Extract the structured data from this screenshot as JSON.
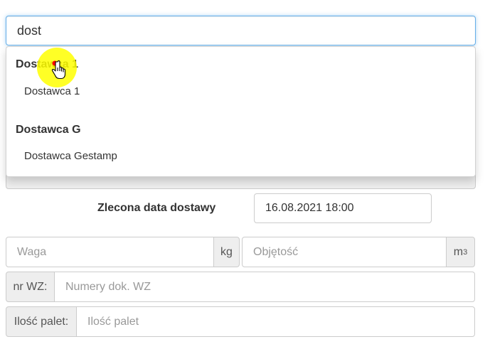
{
  "search": {
    "value": "dost"
  },
  "dropdown": {
    "groups": [
      {
        "header": "Dostawca 1",
        "options": [
          "Dostawca 1"
        ]
      },
      {
        "header": "Dostawca G",
        "options": [
          "Dostawca Gestamp"
        ]
      }
    ]
  },
  "delivery": {
    "label": "Zlecona data dostawy",
    "value": "16.08.2021 18:00"
  },
  "weight": {
    "placeholder": "Waga",
    "unit": "kg"
  },
  "volume": {
    "placeholder": "Objętość",
    "unit": "m",
    "unit_sup": "3"
  },
  "wz": {
    "label": "nr WZ:",
    "placeholder": "Numery dok. WZ"
  },
  "pallets": {
    "label": "Ilość palet:",
    "placeholder": "Ilość palet"
  },
  "colors": {
    "focus_border": "#66afe9",
    "cursor_highlight": "#ffff00",
    "cursor_dot": "#ff0000"
  }
}
